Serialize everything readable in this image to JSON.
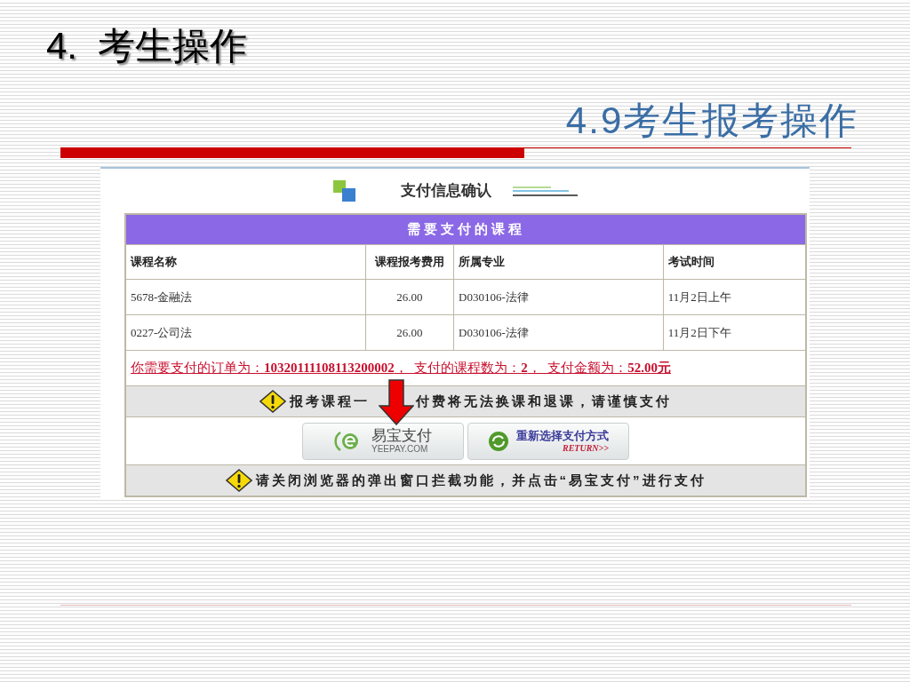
{
  "slide": {
    "title": "4.  考生操作",
    "subtitle": "4.9考生报考操作"
  },
  "payment_page": {
    "title": "支付信息确认",
    "section_heading": "需要支付的课程",
    "columns": [
      "课程名称",
      "课程报考费用",
      "所属专业",
      "考试时间"
    ],
    "rows": [
      [
        "5678-金融法",
        "26.00",
        "D030106-法律",
        "11月2日上午"
      ],
      [
        "0227-公司法",
        "26.00",
        "D030106-法律",
        "11月2日下午"
      ]
    ],
    "order_summary": "你需要支付的订单为：**10320111108113200002**，  支付的课程数为：**2**，  支付金额为：**52.00元**",
    "warning": {
      "before_arrow": "报考课程一",
      "after_arrow": "付费将无法换课和退课，请谨慎支付"
    },
    "buttons": [
      {
        "kind": "yeepay",
        "label": "易宝支付",
        "sublabel": "YEEPAY.COM"
      },
      {
        "kind": "return",
        "label": "重新选择支付方式",
        "sublabel": "RETURN>>"
      }
    ],
    "notice": "请关闭浏览器的弹出窗口拦截功能，并点击“易宝支付”进行支付"
  }
}
